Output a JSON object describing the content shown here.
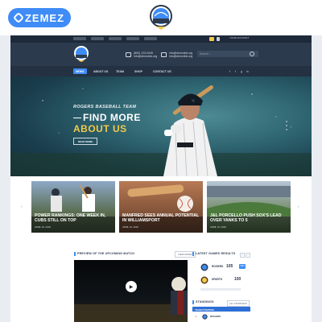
{
  "marketplace": {
    "logo_text": "ZEMEZ"
  },
  "utility_bar": {
    "links": [
      "",
      "",
      "",
      "",
      ""
    ],
    "badge": "",
    "login": "YOUR ACCOUNT"
  },
  "header": {
    "phone": "(800) 123-0045",
    "phone_sub": "info@demolink.org",
    "email": "info@demolink.org",
    "email_sub": "info@demolink.org",
    "search_placeholder": "Search..."
  },
  "nav": {
    "items": [
      "NEWS",
      "ABOUT US",
      "TEAM",
      "SHOP",
      "CONTACT US"
    ],
    "social": [
      "f",
      "t",
      "g",
      "in"
    ]
  },
  "hero": {
    "kicker": "ROGERS BASEBALL TEAM",
    "title_line1": "FIND MORE",
    "title_line2": "ABOUT US",
    "button": "READ MORE"
  },
  "news": [
    {
      "title": "POWER RANKINGS: ONE WEEK IN, CUBS STILL ON TOP",
      "meta": "APRIL 15, 2018"
    },
    {
      "title": "MANFRED SEES ANNUAL POTENTIAL IN WILLIAMSPORT",
      "meta": "APRIL 15, 2018"
    },
    {
      "title": "J&L PORCELLO PUSH SOX'S LEAD OVER YANKS TO 5",
      "meta": "APRIL 15, 2018"
    }
  ],
  "match": {
    "heading": "PREVIEW OF THE UPCOMING MATCH",
    "view_more": "VIEW MORE"
  },
  "results": {
    "heading": "LATEST GAMES RESULTS",
    "team1": "ROGERS",
    "team1_score": "105",
    "team2": "SPARTS",
    "team2_score": "100",
    "badge": "WIN"
  },
  "standings": {
    "heading": "STANDINGS",
    "all_link": "ALL STANDINGS",
    "bar_label": "TEAM POSITION",
    "row_team": "ROGERS"
  },
  "colors": {
    "accent": "#3f8cf6",
    "hero_yellow": "#f2c94c",
    "navy": "#2c3a4d"
  }
}
